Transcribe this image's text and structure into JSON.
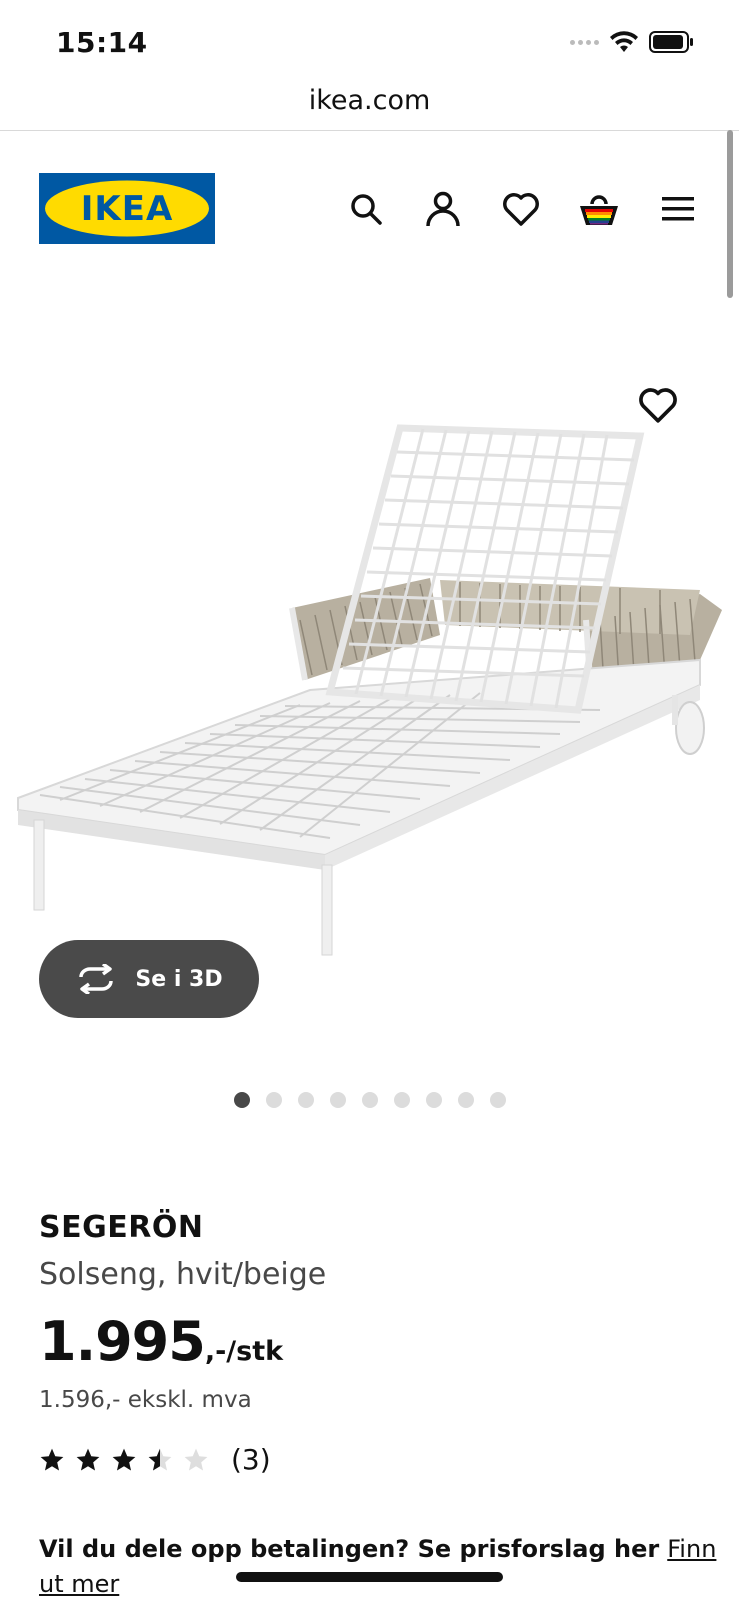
{
  "status_bar": {
    "time": "15:14"
  },
  "browser": {
    "url": "ikea.com"
  },
  "header": {
    "logo_text": "IKEA",
    "icons": [
      "search-icon",
      "user-icon",
      "heart-icon",
      "basket-icon",
      "menu-icon"
    ]
  },
  "gallery": {
    "view_3d_label": "Se i 3D",
    "image_count": 9,
    "active_index": 0
  },
  "product": {
    "name": "SEGERÖN",
    "description": "Solseng, hvit/beige",
    "price": "1.995",
    "price_suffix": ",-/stk",
    "price_ex_vat": "1.596,- ekskl. mva",
    "rating": 3.5,
    "rating_max": 5,
    "review_count": "(3)"
  },
  "payment": {
    "text": "Vil du dele opp betalingen? Se prisforslag her",
    "link": "Finn ut mer"
  },
  "colors": {
    "ikea_blue": "#0058a3",
    "ikea_yellow": "#ffdb00",
    "button_dark": "#4a4a4a"
  }
}
